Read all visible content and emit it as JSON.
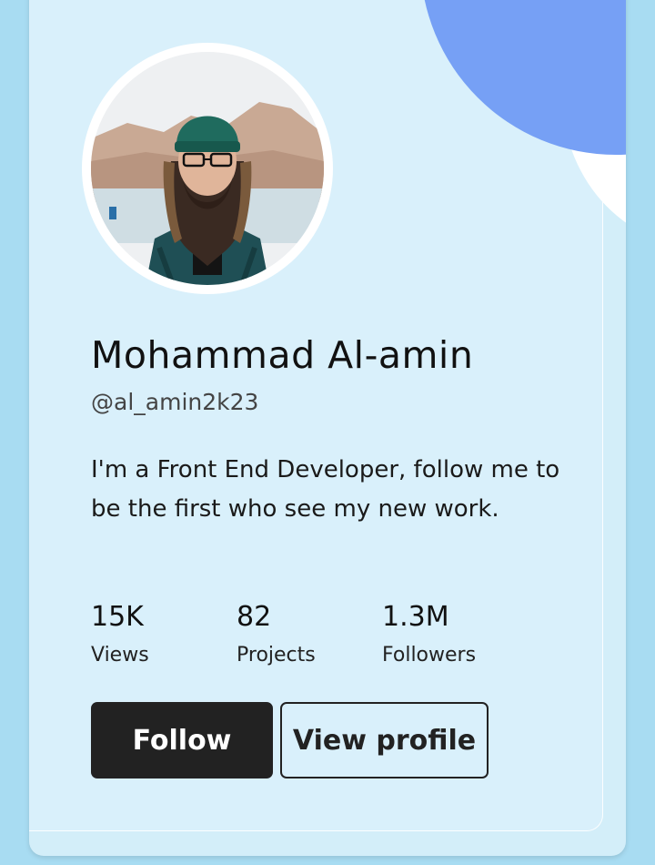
{
  "profile": {
    "name": "Mohammad Al-amin",
    "handle": "@al_amin2k23",
    "bio": "I'm a Front End Developer, follow me to be the first who see my new work."
  },
  "stats": [
    {
      "value": "15K",
      "label": "Views"
    },
    {
      "value": "82",
      "label": "Projects"
    },
    {
      "value": "1.3M",
      "label": "Followers"
    }
  ],
  "actions": {
    "follow_label": "Follow",
    "view_profile_label": "View profile"
  },
  "colors": {
    "background": "#a8dcf2",
    "card": "#d9f0fb",
    "accent_circle": "#76a0f5",
    "button_dark": "#222222"
  }
}
